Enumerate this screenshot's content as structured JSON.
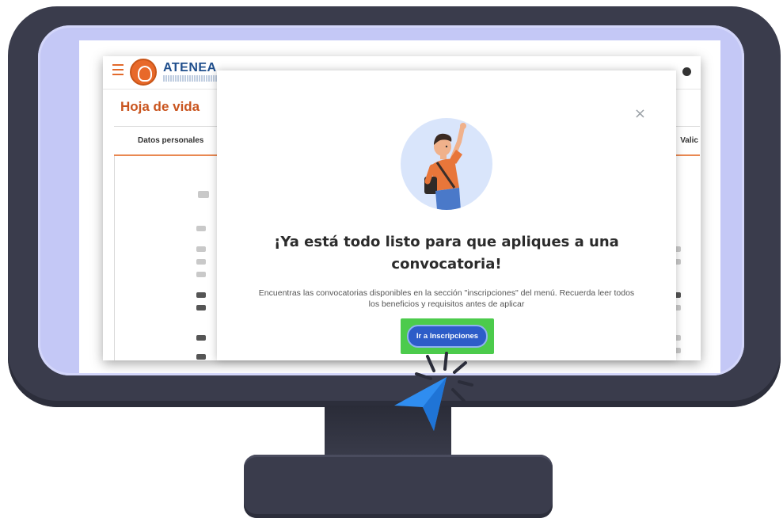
{
  "app": {
    "logo_text": "ATENEA",
    "page_title": "Hoja de vida",
    "tabs": [
      {
        "label": "Datos personales"
      },
      {
        "label": "Valic"
      }
    ]
  },
  "modal": {
    "close_symbol": "×",
    "illustration": "student-waving-illustration",
    "title": "¡Ya está todo listo para que apliques a una convocatoria!",
    "body": "Encuentras las convocatorias disponibles en la sección \"inscripciones\" del menú. Recuerda leer todos los beneficios y requisitos antes de aplicar",
    "cta_label": "Ir a Inscripciones"
  },
  "colors": {
    "monitor_frame": "#3a3c4c",
    "monitor_bezel": "#c4c8f6",
    "brand_orange": "#c9551f",
    "cta_blue": "#2d5cc8",
    "highlight_green": "#4ccb4c",
    "pointer_blue": "#2f8df0"
  }
}
